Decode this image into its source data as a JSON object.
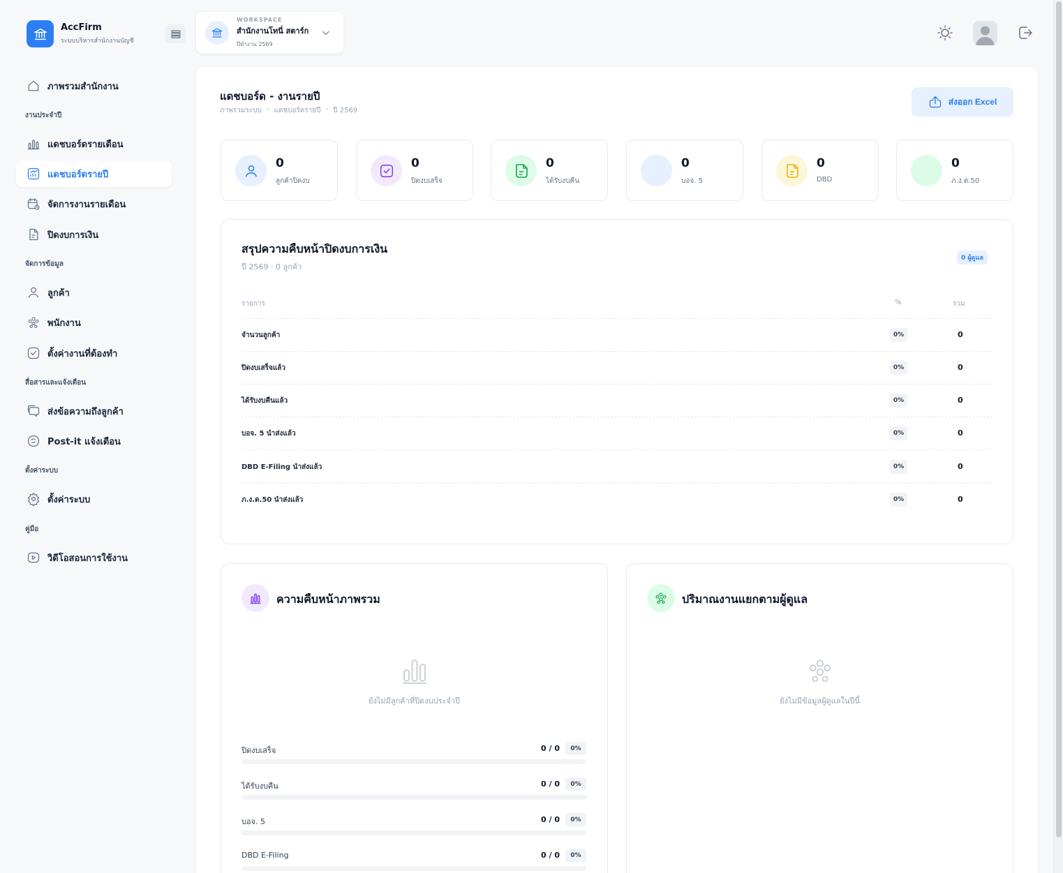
{
  "brand": {
    "name": "AccFirm",
    "subtitle": "ระบบบริหารสำนักงานบัญชี"
  },
  "workspace": {
    "label": "WORKSPACE",
    "name": "สำนักงานโทนี่ สตาร์ก",
    "year": "ปีทำงาน 2569"
  },
  "nav": {
    "overview": "ภาพรวมสำนักงาน",
    "section_yearly": "งานประจำปี",
    "monthly_dashboard": "แดชบอร์ดรายเดือน",
    "yearly_dashboard": "แดชบอร์ดรายปี",
    "monthly_tasks": "จัดการงานรายเดือน",
    "closing": "ปิดงบการเงิน",
    "section_data": "จัดการข้อมูล",
    "customers": "ลูกค้า",
    "employees": "พนักงาน",
    "todo_settings": "ตั้งค่างานที่ต้องทำ",
    "section_comm": "สื่อสารและแจ้งเตือน",
    "send_message": "ส่งข้อความถึงลูกค้า",
    "postit": "Post-it แจ้งเตือน",
    "section_settings": "ตั้งค่าระบบ",
    "system_settings": "ตั้งค่าระบบ",
    "section_manual": "คู่มือ",
    "tutorial": "วิดีโอสอนการใช้งาน"
  },
  "header": {
    "title": "แดชบอร์ด - งานรายปี",
    "breadcrumb": [
      "ภาพรวมระบบ",
      "-",
      "แดชบอร์ดรายปี",
      "-",
      "ปี 2569"
    ],
    "export_label": "ส่งออก Excel"
  },
  "stats": [
    {
      "value": "0",
      "label": "ลูกค้าปิดงบ",
      "color": "#2b7ff2"
    },
    {
      "value": "0",
      "label": "ปิดงบเสร็จ",
      "color": "#7c3aed"
    },
    {
      "value": "0",
      "label": "ได้รับงบคืน",
      "color": "#16a34a"
    },
    {
      "value": "0",
      "label": "บอจ. 5",
      "color": "#2b7ff2"
    },
    {
      "value": "0",
      "label": "DBD",
      "color": "#eab308"
    },
    {
      "value": "0",
      "label": "ภ.ง.ด.50",
      "color": "#22c55e"
    }
  ],
  "summary": {
    "title": "สรุปความคืบหน้าปิดงบการเงิน",
    "subtitle": "ปี 2569 · 0 ลูกค้า",
    "badge": "0 ผู้ดูแล",
    "columns": {
      "item": "รายการ",
      "percent": "%",
      "total": "รวม"
    },
    "rows": [
      {
        "label": "จำนวนลูกค้า",
        "percent": "0%",
        "total": "0"
      },
      {
        "label": "ปิดงบเสร็จแล้ว",
        "percent": "0%",
        "total": "0"
      },
      {
        "label": "ได้รับงบคืนแล้ว",
        "percent": "0%",
        "total": "0"
      },
      {
        "label": "บอจ. 5 นำส่งแล้ว",
        "percent": "0%",
        "total": "0"
      },
      {
        "label": "DBD E-Filing นำส่งแล้ว",
        "percent": "0%",
        "total": "0"
      },
      {
        "label": "ภ.ง.ด.50 นำส่งแล้ว",
        "percent": "0%",
        "total": "0"
      }
    ]
  },
  "progress": {
    "title": "ความคืบหน้าภาพรวม",
    "empty": "ยังไม่มีลูกค้าที่ปิดงบประจำปี",
    "rows": [
      {
        "label": "ปิดงบเสร็จ",
        "count": "0 / 0",
        "percent": "0%",
        "fraction": 0
      },
      {
        "label": "ได้รับงบคืน",
        "count": "0 / 0",
        "percent": "0%",
        "fraction": 0
      },
      {
        "label": "บอจ. 5",
        "count": "0 / 0",
        "percent": "0%",
        "fraction": 0
      },
      {
        "label": "DBD E-Filing",
        "count": "0 / 0",
        "percent": "0%",
        "fraction": 0
      }
    ]
  },
  "workload": {
    "title": "ปริมาณงานแยกตามผู้ดูแล",
    "empty": "ยังไม่มีข้อมูลผู้ดูแลในปีนี้"
  },
  "colors": {
    "accent": "#2b7ff2",
    "purple": "#7c3aed",
    "green": "#16a34a",
    "yellow": "#eab308"
  }
}
